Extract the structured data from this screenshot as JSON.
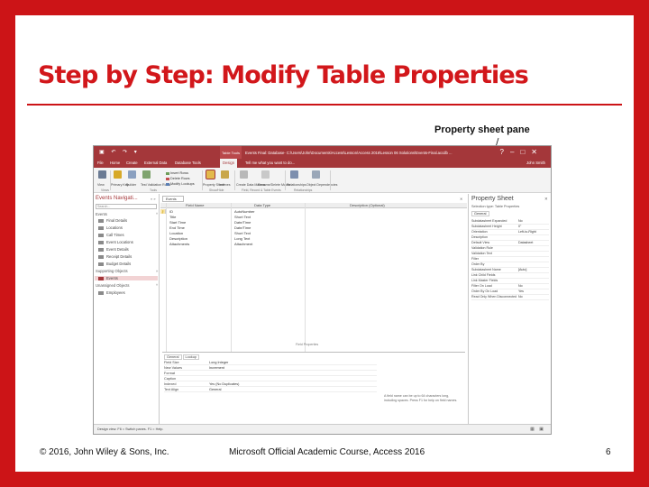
{
  "slide": {
    "title": "Step by Step: Modify Table Properties",
    "callout": "Property sheet pane",
    "footer_left": "© 2016, John Wiley & Sons, Inc.",
    "footer_center": "Microsoft Official Academic Course, Access 2016",
    "page_number": "6"
  },
  "colors": {
    "brand": "#cc1417",
    "title": "#d2171b",
    "access": "#a4373a"
  },
  "window": {
    "title_path": "Events Final: Database- C:\\Users\\John\\Documents\\Access\\Lesson\\Access 2016\\Lesson 06 Solutions\\Events-Final.accdb ...",
    "context_tab": "Table Tools",
    "tabs": [
      "File",
      "Home",
      "Create",
      "External Data",
      "Database Tools",
      "Design",
      "Tell me what you want to do..."
    ],
    "active_tab": "Design",
    "user": "John Smith",
    "controls": [
      "?",
      "–",
      "□",
      "✕"
    ],
    "ribbon": {
      "buttons": [
        "View",
        "Primary Key",
        "Builder",
        "Test Validation Rules",
        "Property Sheet",
        "Indexes",
        "Create Data Macros",
        "Rename/Delete Macro",
        "Relationships",
        "Object Dependencies"
      ],
      "small_items": [
        "Insert Rows",
        "Delete Rows",
        "Modify Lookups"
      ],
      "groups": [
        "Views",
        "Tools",
        "Show/Hide",
        "Field, Record & Table Events",
        "Relationships"
      ]
    }
  },
  "nav": {
    "header": "Events Navigati...",
    "tools": "« »",
    "search_placeholder": "Search...",
    "groups": [
      {
        "label": "Events",
        "items": [
          "Final Details",
          "Locations",
          "Call Times",
          "Event Locations",
          "Event Details",
          "Receipt Details",
          "Budget Details"
        ]
      },
      {
        "label": "Supporting Objects",
        "items": [
          "Events"
        ]
      },
      {
        "label": "Unassigned Objects",
        "items": [
          "Employees"
        ]
      }
    ],
    "selected_item": "Events"
  },
  "doc": {
    "tab_label": "Events",
    "close_glyph": "✕",
    "columns": [
      "Field Name",
      "Data Type",
      "Description (Optional)"
    ],
    "rows": [
      {
        "field": "ID",
        "type": "AutoNumber",
        "key": true
      },
      {
        "field": "Title",
        "type": "Short Text",
        "key": false
      },
      {
        "field": "Start Time",
        "type": "Date/Time",
        "key": false
      },
      {
        "field": "End Time",
        "type": "Date/Time",
        "key": false
      },
      {
        "field": "Location",
        "type": "Short Text",
        "key": false
      },
      {
        "field": "Description",
        "type": "Long Text",
        "key": false
      },
      {
        "field": "Attachments",
        "type": "Attachment",
        "key": false
      }
    ],
    "field_props_label": "Field Properties",
    "field_props_tabs": [
      "General",
      "Lookup"
    ],
    "field_props": [
      {
        "k": "Field Size",
        "v": "Long Integer"
      },
      {
        "k": "New Values",
        "v": "Increment"
      },
      {
        "k": "Format",
        "v": ""
      },
      {
        "k": "Caption",
        "v": ""
      },
      {
        "k": "Indexed",
        "v": "Yes (No Duplicates)"
      },
      {
        "k": "Text Align",
        "v": "General"
      }
    ],
    "help_text": "A field name can be up to 64 characters long, including spaces. Press F1 for help on field names."
  },
  "props": {
    "title": "Property Sheet",
    "close": "✕",
    "selection": "Selection type: Table Properties",
    "tab": "General",
    "rows": [
      {
        "k": "Subdatasheet Expanded",
        "v": "No"
      },
      {
        "k": "Subdatasheet Height",
        "v": "0\""
      },
      {
        "k": "Orientation",
        "v": "Left-to-Right"
      },
      {
        "k": "Description",
        "v": ""
      },
      {
        "k": "Default View",
        "v": "Datasheet"
      },
      {
        "k": "Validation Rule",
        "v": ""
      },
      {
        "k": "Validation Text",
        "v": ""
      },
      {
        "k": "Filter",
        "v": ""
      },
      {
        "k": "Order By",
        "v": ""
      },
      {
        "k": "Subdatasheet Name",
        "v": "[Auto]"
      },
      {
        "k": "Link Child Fields",
        "v": ""
      },
      {
        "k": "Link Master Fields",
        "v": ""
      },
      {
        "k": "Filter On Load",
        "v": "No"
      },
      {
        "k": "Order By On Load",
        "v": "Yes"
      },
      {
        "k": "Read Only When Disconnected",
        "v": "No"
      }
    ]
  },
  "statusbar": {
    "text": "Design view.  F6 = Switch panes.  F1 = Help.",
    "icons": "▦ ▣"
  }
}
